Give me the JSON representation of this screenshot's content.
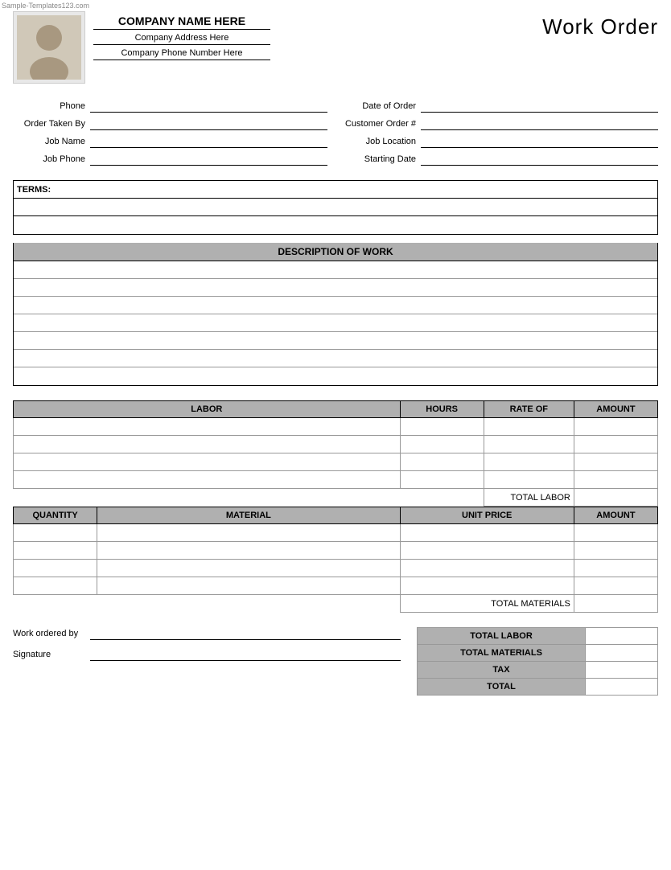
{
  "watermark": "Sample-Templates123.com",
  "header": {
    "company_name": "COMPANY NAME HERE",
    "company_address": "Company Address Here",
    "company_phone": "Company Phone Number Here",
    "title": "Work Order"
  },
  "form": {
    "left": [
      {
        "label": "Phone",
        "value": ""
      },
      {
        "label": "Order Taken By",
        "value": ""
      },
      {
        "label": "Job Name",
        "value": ""
      },
      {
        "label": "Job Phone",
        "value": ""
      }
    ],
    "right": [
      {
        "label": "Date of Order",
        "value": ""
      },
      {
        "label": "Customer Order #",
        "value": ""
      },
      {
        "label": "Job Location",
        "value": ""
      },
      {
        "label": "Starting Date",
        "value": ""
      }
    ]
  },
  "terms": {
    "label": "TERMS:",
    "rows": 3
  },
  "description": {
    "header": "DESCRIPTION OF WORK",
    "rows": 7
  },
  "labor": {
    "columns": [
      "LABOR",
      "HOURS",
      "RATE OF",
      "AMOUNT"
    ],
    "rows": 4,
    "total_label": "TOTAL LABOR"
  },
  "materials": {
    "columns": [
      "QUANTITY",
      "MATERIAL",
      "UNIT PRICE",
      "AMOUNT"
    ],
    "rows": 4,
    "total_label": "TOTAL MATERIALS"
  },
  "summary": {
    "rows": [
      {
        "label": "TOTAL LABOR",
        "value": ""
      },
      {
        "label": "TOTAL MATERIALS",
        "value": ""
      },
      {
        "label": "TAX",
        "value": ""
      },
      {
        "label": "TOTAL",
        "value": ""
      }
    ]
  },
  "bottom": {
    "work_ordered_by": "Work ordered by",
    "signature": "Signature"
  }
}
